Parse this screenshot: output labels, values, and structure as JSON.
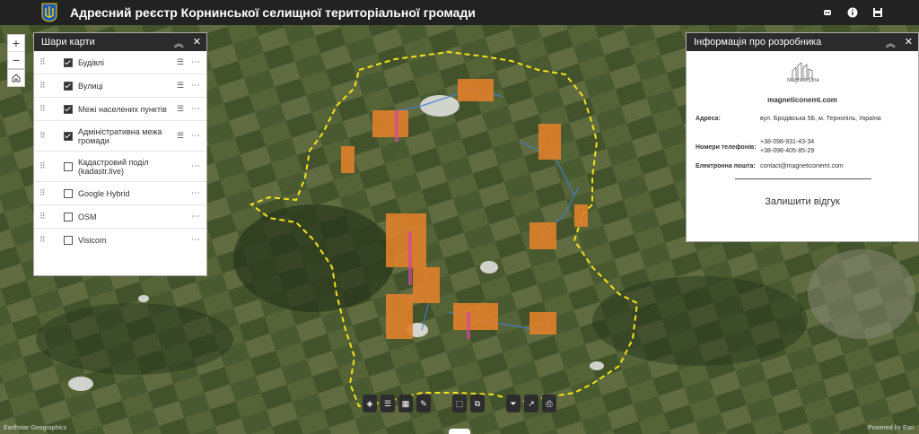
{
  "header": {
    "title": "Адресний реєстр Корнинської селищної територіальної громади",
    "icons": [
      "robot-icon",
      "info-icon",
      "save-icon"
    ]
  },
  "map_controls": {
    "zoom_in": "+",
    "zoom_out": "−"
  },
  "layers_panel": {
    "title": "Шари карти",
    "items": [
      {
        "label": "Будівлі",
        "checked": true
      },
      {
        "label": "Вулиці",
        "checked": true
      },
      {
        "label": "Межі населених пунктів",
        "checked": true
      },
      {
        "label": "Адміністративна межа громади",
        "checked": true
      },
      {
        "label": "Кадастровий поділ (kadastr.live)",
        "checked": false
      },
      {
        "label": "Google Hybrid",
        "checked": false
      },
      {
        "label": "OSM",
        "checked": false
      },
      {
        "label": "Visicom",
        "checked": false
      }
    ]
  },
  "info_panel": {
    "title": "Інформація про розробника",
    "logo_text": "MagneticOne",
    "site": "magneticonemt.com",
    "address_label": "Адреса:",
    "address_value": "вул. Бродівська 5Б, м. Тернопіль, Україна",
    "phones_label": "Номери телефонів:",
    "phone1": "+38-098-931-43-34",
    "phone2": "+38-098-405-85-29",
    "email_label": "Електронна пошта:",
    "email_value": "contact@magneticonemt.com",
    "feedback": "Залишити відгук"
  },
  "attribution": {
    "left": "Earthstar Geographics",
    "right": "Powered by Esri"
  },
  "colors": {
    "boundary": "#f5e11a",
    "buildings": "#e0802a",
    "streets": "#3f7fd0"
  }
}
